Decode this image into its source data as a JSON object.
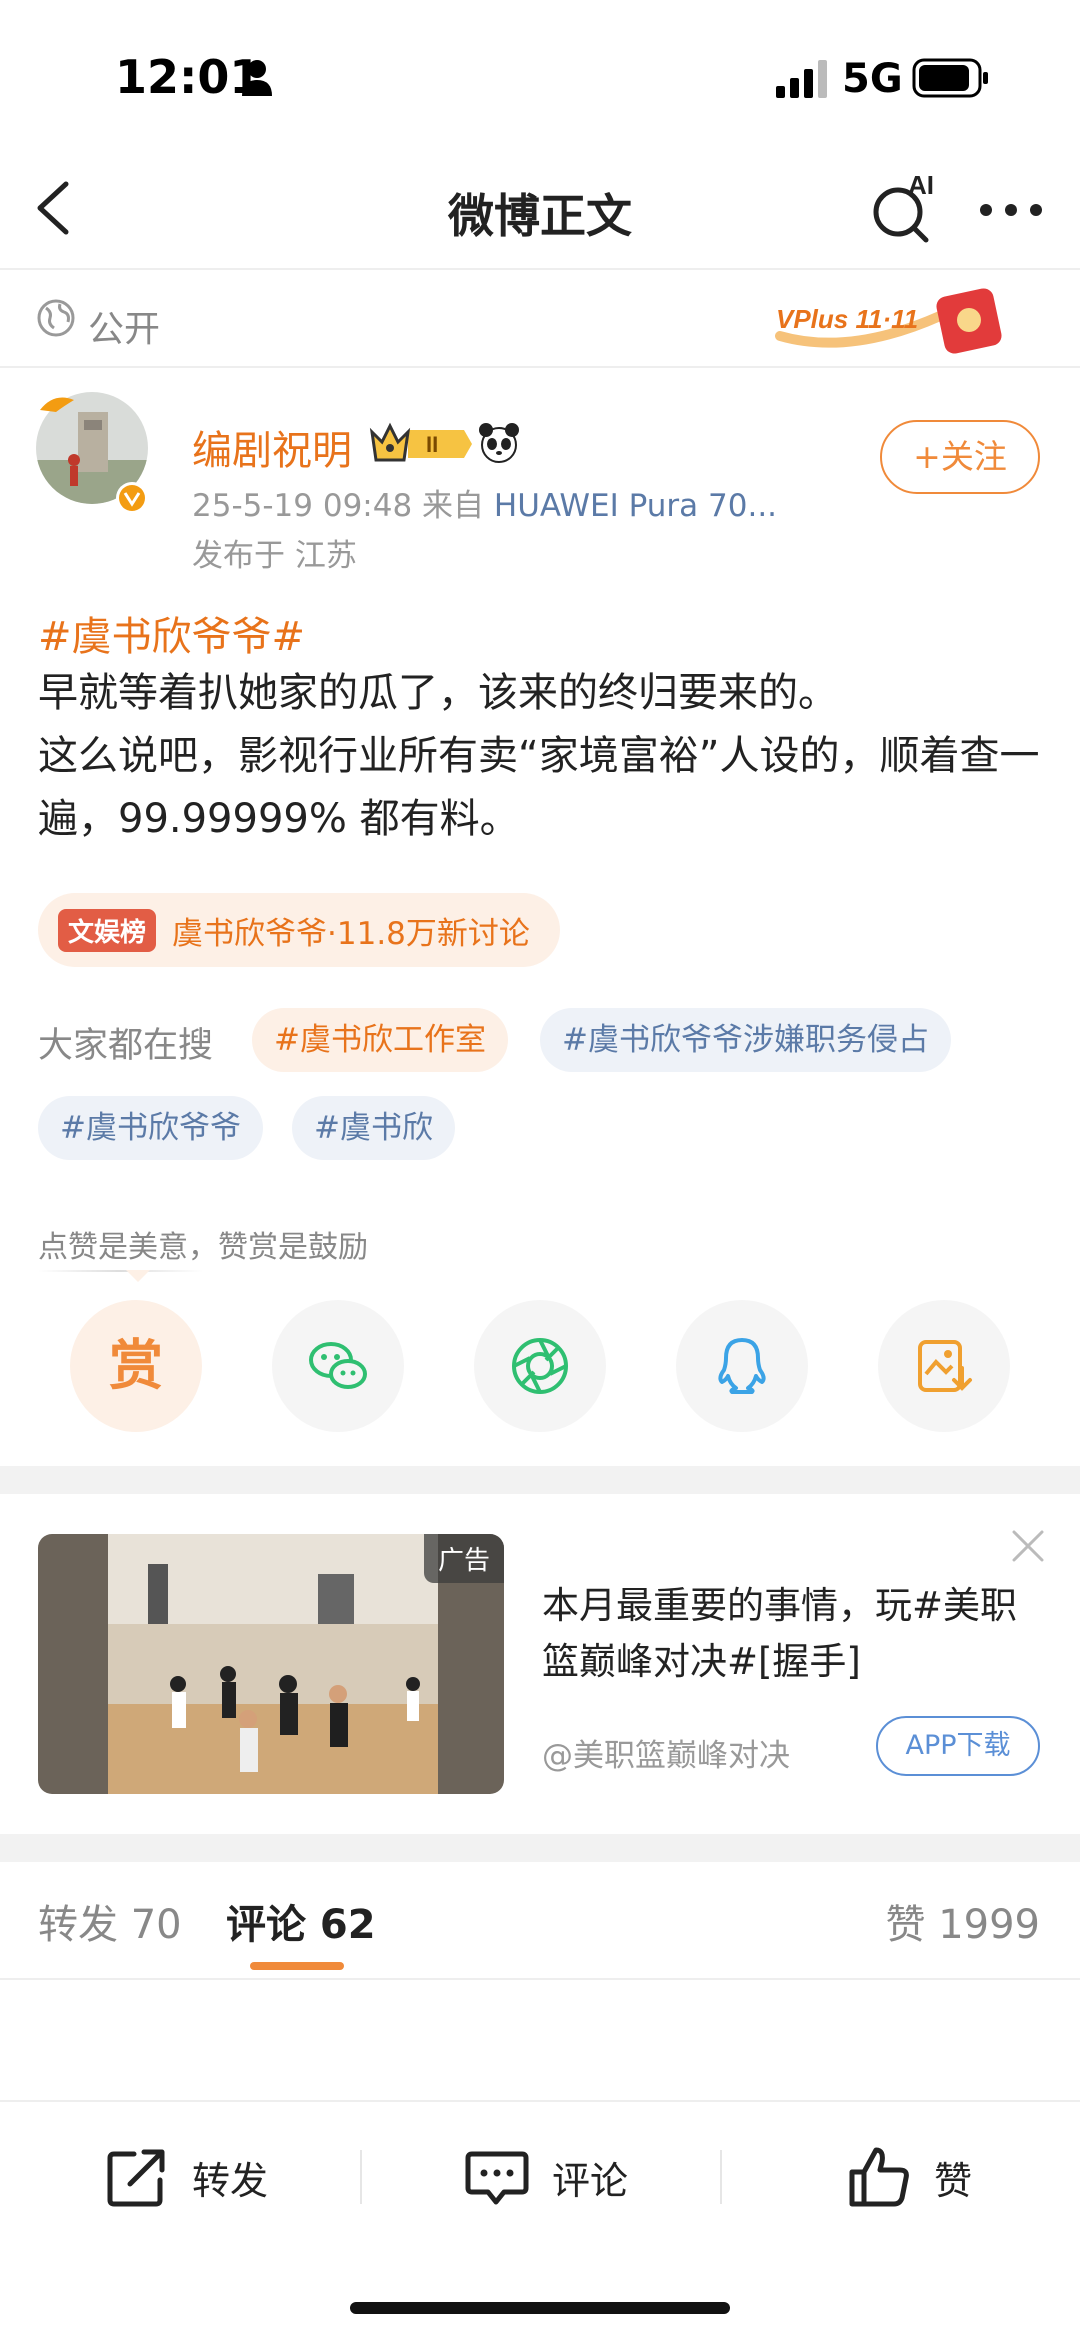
{
  "status_bar": {
    "time": "12:01",
    "network": "5G"
  },
  "nav": {
    "title": "微博正文",
    "ai_label": "AI"
  },
  "visibility": {
    "label": "公开",
    "banner_text": "VPlus 11·11"
  },
  "author": {
    "name": "编剧祝明",
    "level": "II",
    "meta_prefix": "25-5-19 09:48  来自 ",
    "source": "HUAWEI Pura 70...",
    "location": "发布于 江苏",
    "follow_label": "+关注"
  },
  "post": {
    "hashtag": "#虞书欣爷爷#",
    "lines": [
      "早就等着扒她家的瓜了，该来的终归要来的。",
      "这么说吧，影视行业所有卖“家境富裕”人设的，顺着查一遍，99.99999% 都有料。"
    ]
  },
  "trending": {
    "tag": "文娱榜",
    "text": "虞书欣爷爷·11.8万新讨论"
  },
  "search": {
    "label": "大家都在搜",
    "chips": [
      "#虞书欣工作室",
      "#虞书欣爷爷涉嫌职务侵占",
      "#虞书欣爷爷",
      "#虞书欣"
    ]
  },
  "reward": {
    "label": "点赞是美意，赞赏是鼓励",
    "button_char": "赏"
  },
  "ad": {
    "badge": "广告",
    "text": "本月最重要的事情，玩#美职篮巅峰对决#[握手]",
    "source": "@美职篮巅峰对决",
    "button": "APP下载"
  },
  "tabs": {
    "repost": "转发 70",
    "comment": "评论 62",
    "like": "赞 1999"
  },
  "bottom_bar": {
    "repost": "转发",
    "comment": "评论",
    "like": "赞"
  },
  "colors": {
    "accent": "#f08a3a",
    "link": "#5b7aa7",
    "orange_text": "#e8731b"
  }
}
